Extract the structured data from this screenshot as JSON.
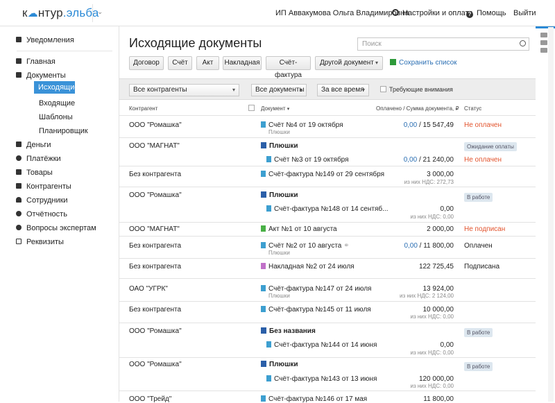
{
  "app": {
    "logo_a": "к",
    "logo_b": "нтур",
    "logo_c": ".эльба",
    "user": "ИП Аввакумова Ольга Владимировна",
    "settings": "Настройки и оплата",
    "help": "Помощь",
    "exit": "Выйти"
  },
  "sidebar": {
    "notifications": "Уведомления",
    "items": [
      "Главная",
      "Документы",
      "Исходящие",
      "Входящие",
      "Шаблоны",
      "Планировщик",
      "Деньги",
      "Платёжки",
      "Товары",
      "Контрагенты",
      "Сотрудники",
      "Отчётность",
      "Вопросы экспертам",
      "Реквизиты"
    ]
  },
  "main": {
    "title": "Исходящие документы",
    "search_placeholder": "Поиск",
    "buttons": [
      "Договор",
      "Счёт",
      "Акт",
      "Накладная",
      "Счёт-фактура",
      "Другой документ"
    ],
    "save_list": "Сохранить список",
    "filters": {
      "contractors": "Все контрагенты",
      "documents": "Все документы",
      "period": "За все время",
      "attention": "Требующие внимания"
    },
    "headers": {
      "contractor": "Контрагент",
      "document": "Документ",
      "amount": "Оплачено / Сумма документа, ₽",
      "status": "Статус"
    }
  },
  "rows": [
    {
      "contractor": "ООО \"Ромашка\"",
      "doc": "Счёт №4 от 19 октября",
      "doc_sub": "Плюшки",
      "paid": "0,00",
      "sum": " / 15 547,49",
      "status": "Не оплачен"
    },
    {
      "contractor": "ООО \"МАГНАТ\"",
      "group": "Плюшки",
      "badge": "Ожидание оплаты",
      "doc": "Счёт №3 от 19 октября",
      "paid": "0,00",
      "sum": " / 21 240,00",
      "status": "Не оплачен"
    },
    {
      "contractor": "Без контрагента",
      "doc": "Счёт-фактура №149 от 29 сентября",
      "sum": "3 000,00",
      "vat": "из них НДС: 272,73"
    },
    {
      "contractor": "ООО \"Ромашка\"",
      "group": "Плюшки",
      "badge": "В работе",
      "doc": "Счёт-фактура №148 от 14 сентяб...",
      "sum": "0,00",
      "vat": "из них НДС: 0,00"
    },
    {
      "contractor": "ООО \"МАГНАТ\"",
      "doc": "Акт №1 от 10 августа",
      "sum": "2 000,00",
      "status": "Не подписан"
    },
    {
      "contractor": "Без контрагента",
      "doc": "Счёт №2 от 10 августа",
      "doc_sub": "Плюшки",
      "paid": "0,00",
      "sum": " / 11 800,00",
      "status": "Оплачен"
    },
    {
      "contractor": "Без контрагента",
      "doc": "Накладная №2 от 24 июля",
      "sum": "122 725,45",
      "status": "Подписана"
    },
    {
      "contractor": "ОАО \"УГРК\"",
      "doc": "Счёт-фактура №147 от 24 июля",
      "doc_sub": "Плюшки",
      "sum": "13 924,00",
      "vat": "из них НДС: 2 124,00"
    },
    {
      "contractor": "Без контрагента",
      "doc": "Счёт-фактура №145 от 11 июля",
      "sum": "10 000,00",
      "vat": "из них НДС: 0,00"
    },
    {
      "contractor": "ООО \"Ромашка\"",
      "group": "Без названия",
      "badge": "В работе",
      "doc": "Счёт-фактура №144 от 14 июня",
      "sum": "0,00",
      "vat": "из них НДС: 0,00"
    },
    {
      "contractor": "ООО \"Ромашка\"",
      "group": "Плюшки",
      "badge": "В работе",
      "doc": "Счёт-фактура №143 от 13 июня",
      "sum": "120 000,00",
      "vat": "из них НДС: 0,00"
    },
    {
      "contractor": "ООО \"Трейд\"",
      "doc": "Счёт-фактура №146 от 17 мая",
      "sum": "11 800,00"
    }
  ]
}
